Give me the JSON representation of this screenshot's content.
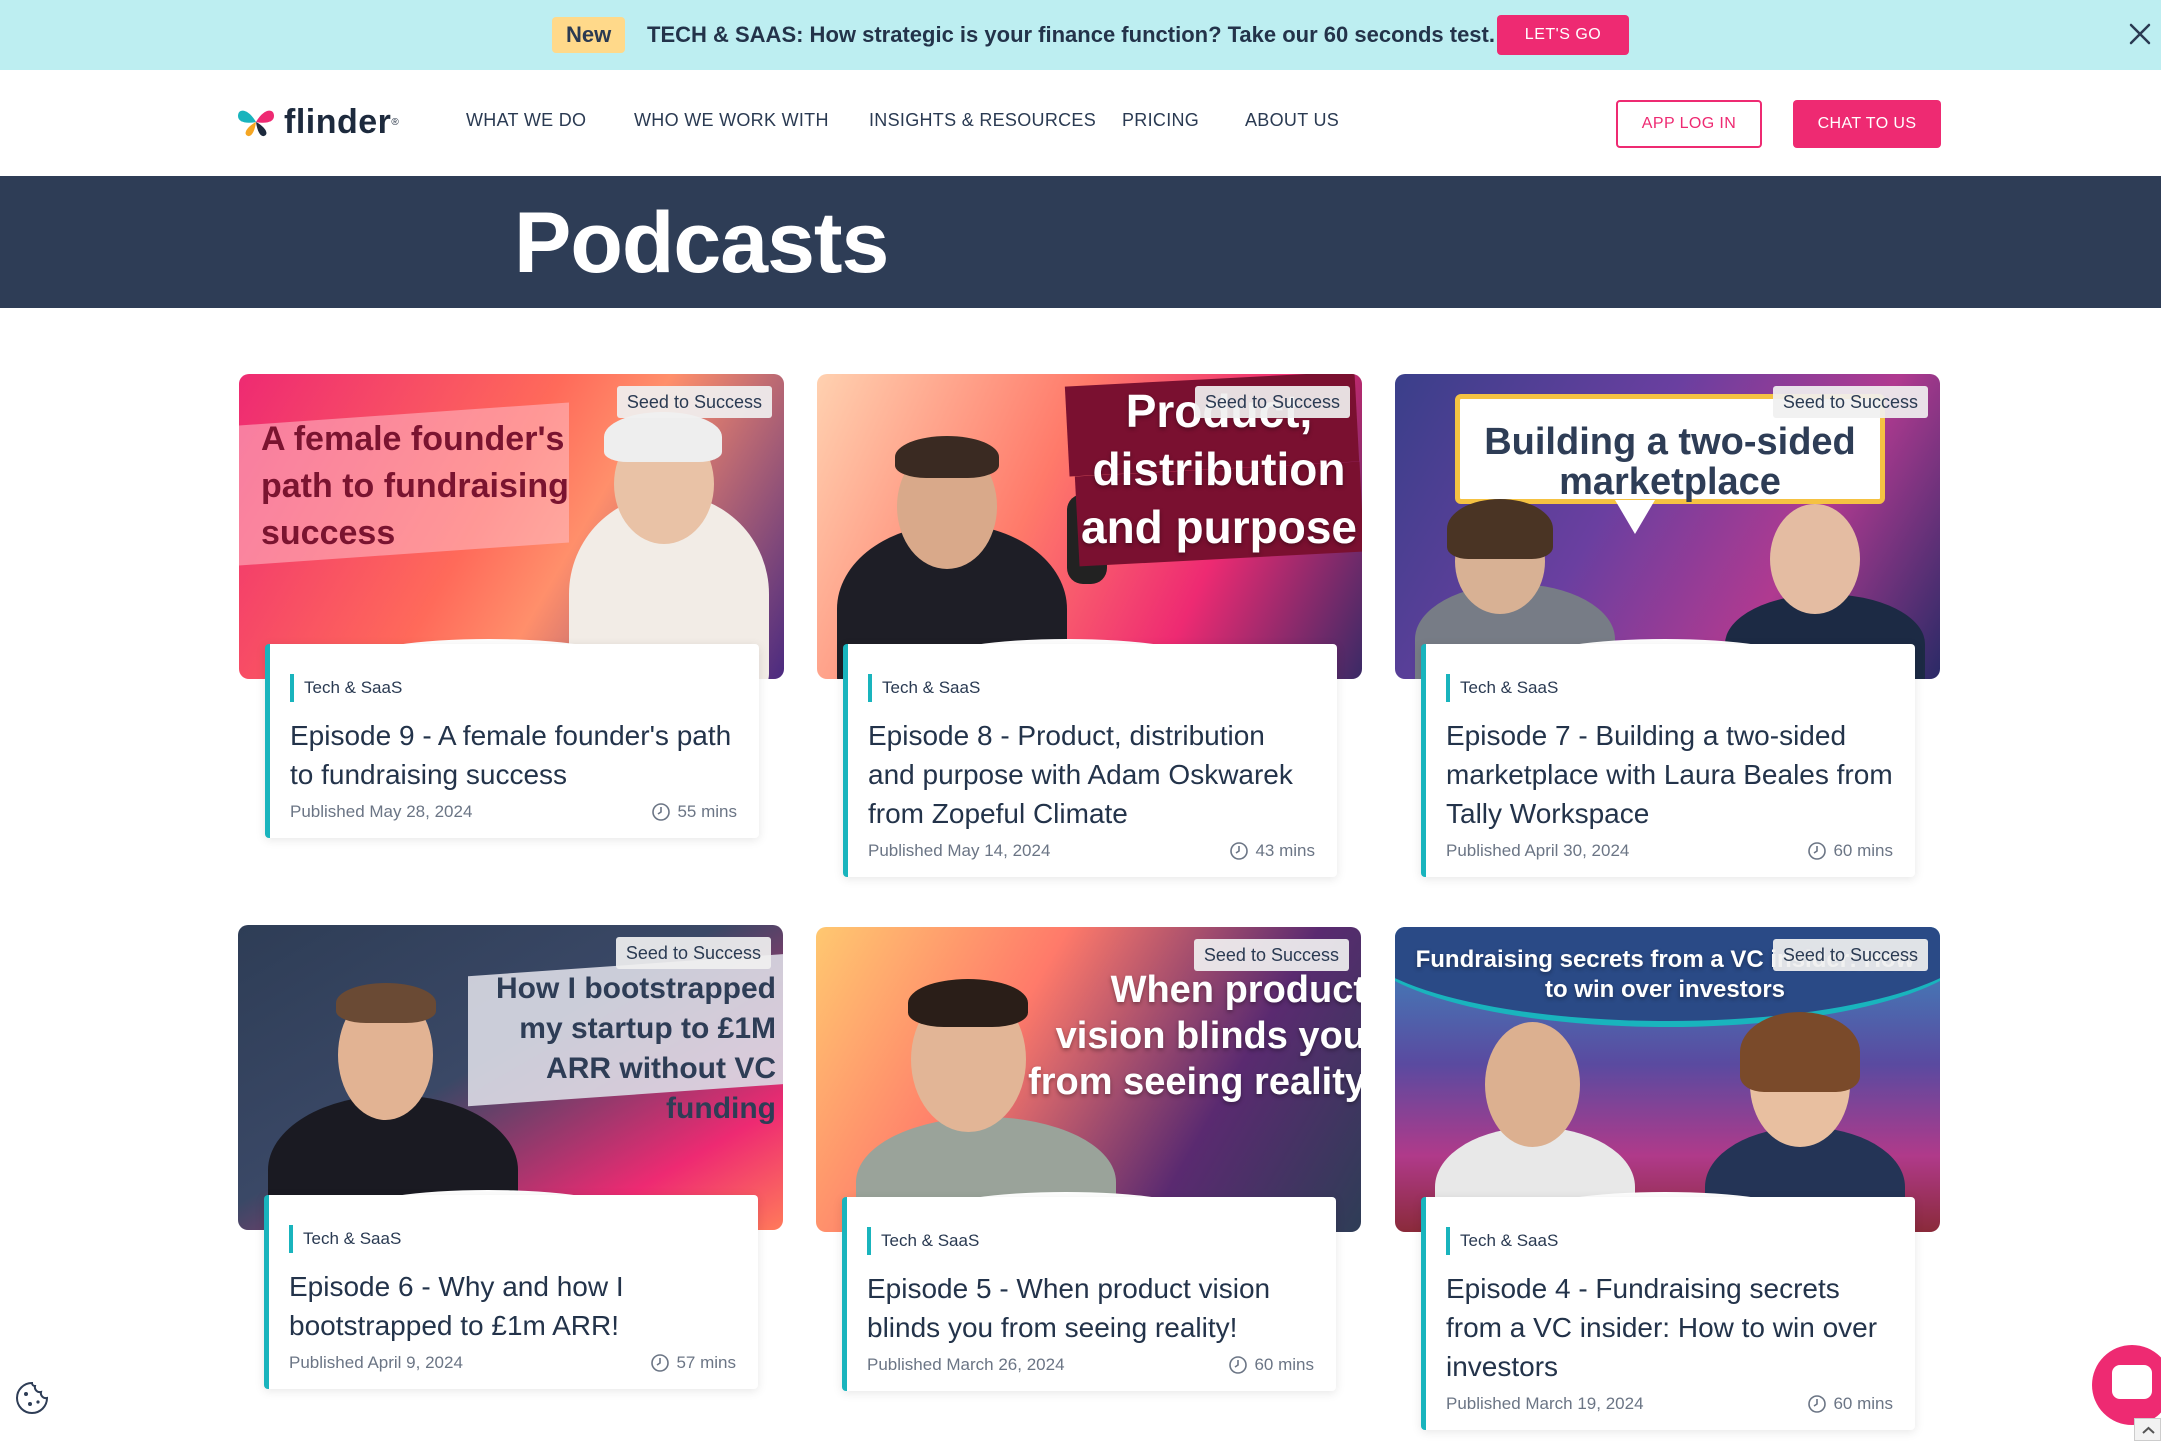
{
  "announcement": {
    "badge": "New",
    "message": "TECH & SAAS: How strategic is your finance function? Take our 60 seconds test.",
    "cta": "LET'S GO",
    "accent": "#ee2a72",
    "background": "#bdeef1"
  },
  "nav": {
    "logo_text": "flinder",
    "items": [
      {
        "label": "WHAT WE DO"
      },
      {
        "label": "WHO WE WORK WITH"
      },
      {
        "label": "INSIGHTS & RESOURCES"
      },
      {
        "label": "PRICING"
      },
      {
        "label": "ABOUT US"
      }
    ],
    "login": "APP LOG IN",
    "chat": "CHAT TO US"
  },
  "hero": {
    "title": "Podcasts",
    "background": "#2e3d56"
  },
  "episodes": [
    {
      "series": "Seed to Success",
      "thumb_text": "A female founder's path to fundraising success",
      "category": "Tech & SaaS",
      "title": "Episode 9 - A female founder's path to fundraising success",
      "published": "Published May 28, 2024",
      "duration": "55 mins"
    },
    {
      "series": "Seed to Success",
      "thumb_text": "Product, distribution and purpose",
      "category": "Tech & SaaS",
      "title": "Episode 8 - Product, distribution and purpose with Adam Oskwarek from Zopeful Climate",
      "published": "Published May 14, 2024",
      "duration": "43 mins"
    },
    {
      "series": "Seed to Success",
      "thumb_text": "Building a two-sided marketplace",
      "category": "Tech & SaaS",
      "title": "Episode 7 - Building a two-sided marketplace with Laura Beales from Tally Workspace",
      "published": "Published April 30, 2024",
      "duration": "60 mins"
    },
    {
      "series": "Seed to Success",
      "thumb_text": "How I bootstrapped my startup to £1M ARR without VC funding",
      "category": "Tech & SaaS",
      "title": "Episode 6 - Why and how I bootstrapped to £1m ARR!",
      "published": "Published April 9, 2024",
      "duration": "57 mins"
    },
    {
      "series": "Seed to Success",
      "thumb_text": "When product vision blinds you from seeing reality",
      "category": "Tech & SaaS",
      "title": "Episode 5 - When product vision blinds you from seeing reality!",
      "published": "Published March 26, 2024",
      "duration": "60 mins"
    },
    {
      "series": "Seed to Success",
      "thumb_text": "Fundraising secrets from a VC insider: How to win over investors",
      "category": "Tech & SaaS",
      "title": "Episode 4 - Fundraising secrets from a VC insider: How to win over investors",
      "published": "Published March 19, 2024",
      "duration": "60 mins"
    }
  ],
  "icons": {
    "close": "close-icon",
    "clock": "clock-icon",
    "cookie": "cookie-icon",
    "chat": "chat-icon",
    "scroll": "chevron-up-icon"
  }
}
